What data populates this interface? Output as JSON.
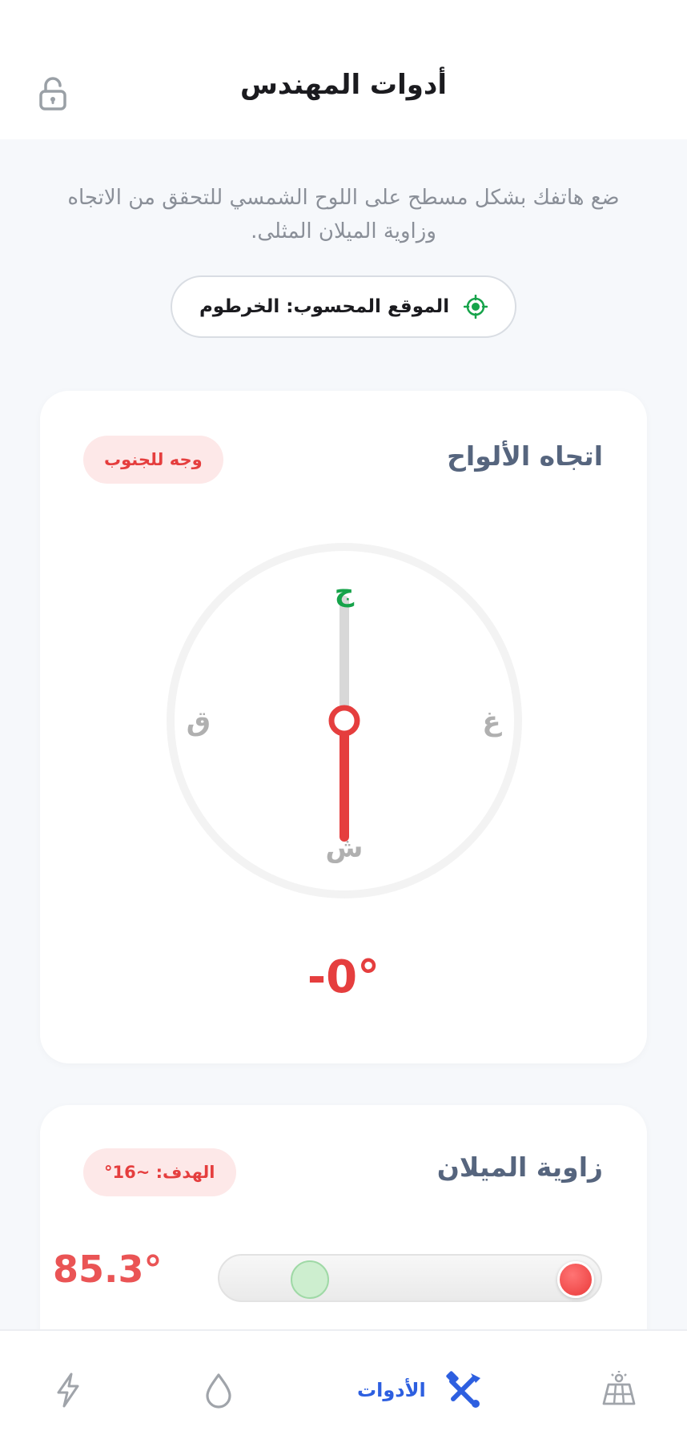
{
  "header": {
    "title": "أدوات المهندس",
    "lock_icon": "lock-icon"
  },
  "instructions": "ضع هاتفك بشكل مسطح على اللوح الشمسي للتحقق من الاتجاه وزاوية الميلان المثلى.",
  "location": {
    "label": "الموقع المحسوب: الخرطوم",
    "icon": "target-icon",
    "icon_color": "#16a34a"
  },
  "orientation_card": {
    "title": "اتجاه الألواح",
    "badge": "وجه للجنوب",
    "compass": {
      "north": "ش",
      "south": "ج",
      "east": "ق",
      "west": "غ",
      "south_color": "#16a34a"
    },
    "heading": "-0°"
  },
  "tilt_card": {
    "title": "زاوية الميلان",
    "badge": "الهدف: ~16°",
    "current": "85.3°",
    "target_position": 0.2,
    "current_position": 1.0
  },
  "bottom_nav": {
    "items": [
      {
        "icon": "solar-panel-icon",
        "label": ""
      },
      {
        "icon": "tools-icon",
        "label": "الأدوات",
        "active": true
      },
      {
        "icon": "water-drop-icon",
        "label": ""
      },
      {
        "icon": "lightning-icon",
        "label": ""
      }
    ],
    "active_color": "#2d5fe0"
  }
}
